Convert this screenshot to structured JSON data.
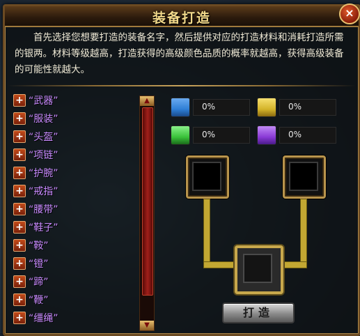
{
  "window": {
    "title": "装备打造",
    "close_label": "×"
  },
  "description": "首先选择您想要打造的装备名字，然后提供对应的打造材料和消耗打造所需的银两。材料等级越高，打造获得的高级颜色品质的概率就越高，获得高级装备的可能性就越大。",
  "equipment_list": [
    {
      "label": "“武器”"
    },
    {
      "label": "“服装”"
    },
    {
      "label": "“头盔”"
    },
    {
      "label": "“项链”"
    },
    {
      "label": "“护腕”"
    },
    {
      "label": "“戒指”"
    },
    {
      "label": "“腰带”"
    },
    {
      "label": "“鞋子”"
    },
    {
      "label": "“鞍”"
    },
    {
      "label": "“镫”"
    },
    {
      "label": "“蹄”"
    },
    {
      "label": "“鞭”"
    },
    {
      "label": "“缰绳”"
    }
  ],
  "quality": [
    {
      "color": "#2f7fd6",
      "value": "0%",
      "icon": "blue-quality-icon"
    },
    {
      "color": "#d4b42a",
      "value": "0%",
      "icon": "gold-quality-icon"
    },
    {
      "color": "#3ac23a",
      "value": "0%",
      "icon": "green-quality-icon"
    },
    {
      "color": "#8a3ad6",
      "value": "0%",
      "icon": "purple-quality-icon"
    }
  ],
  "forge_button_label": "打造",
  "plus_label": "+",
  "scroll": {
    "up": "▲",
    "down": "▼"
  }
}
